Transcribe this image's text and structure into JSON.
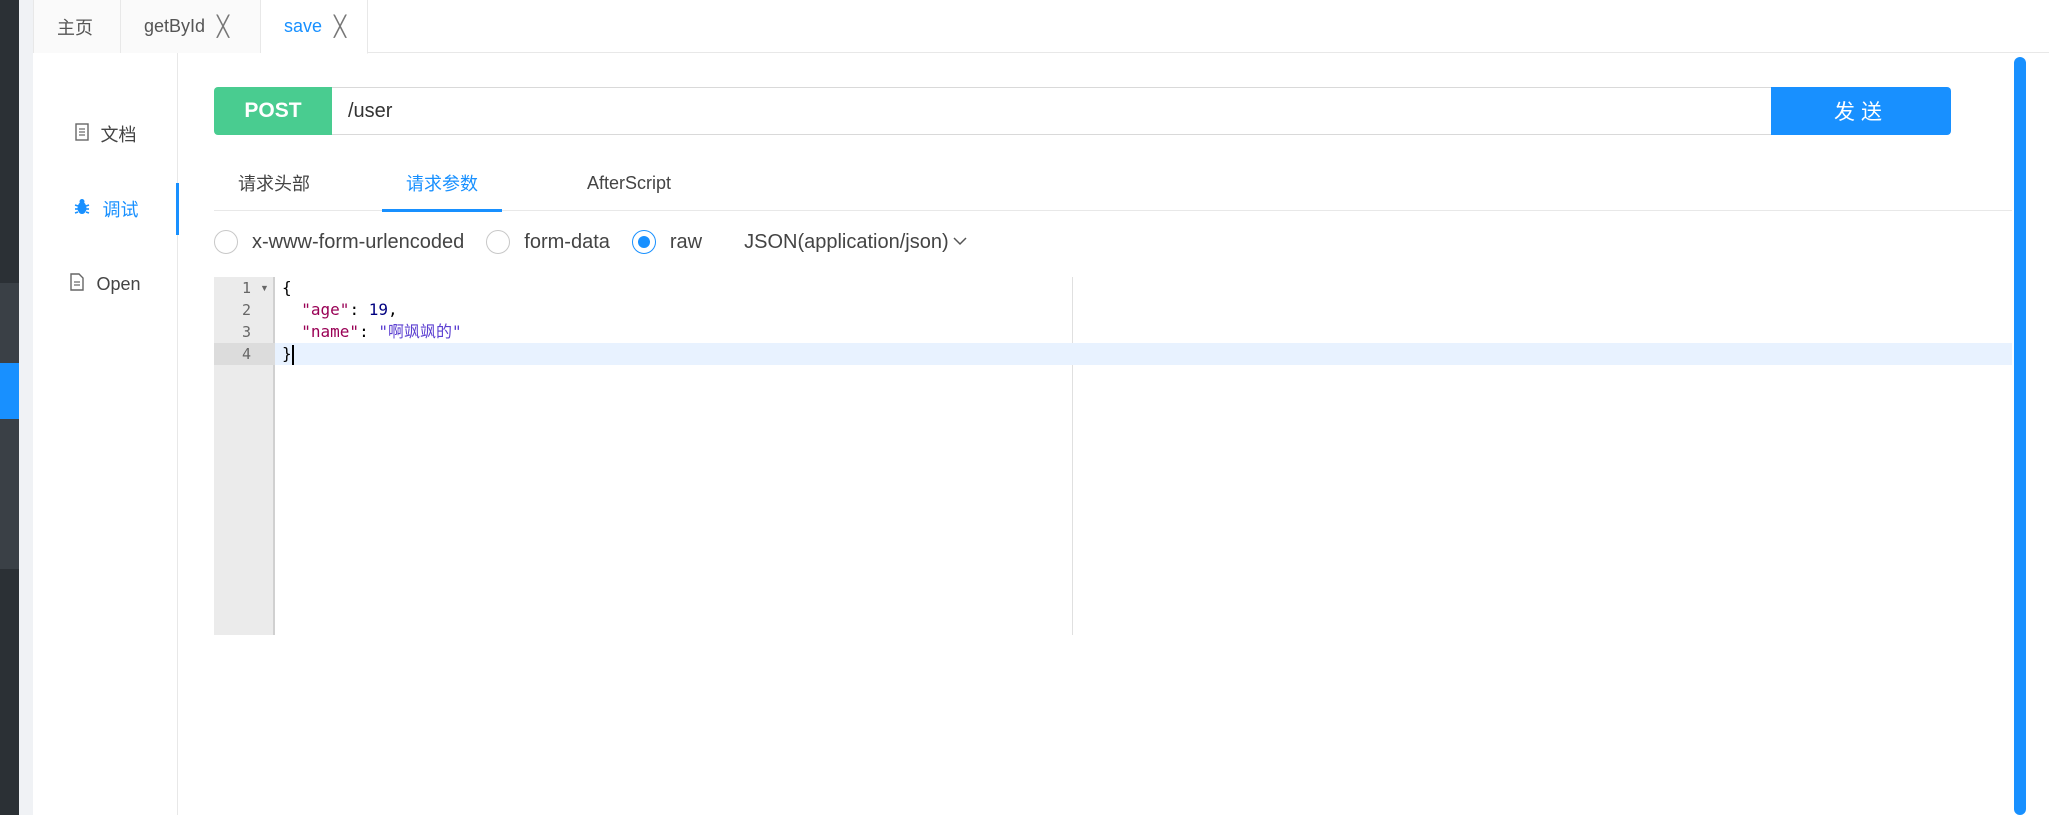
{
  "tabs": [
    {
      "label": "主页",
      "closable": false
    },
    {
      "label": "getById",
      "closable": true
    },
    {
      "label": "save",
      "closable": true,
      "active": true
    }
  ],
  "tab_close_glyph": "╳",
  "nav": {
    "doc": "文档",
    "debug": "调试",
    "open": "Open"
  },
  "request": {
    "method": "POST",
    "url": "/user",
    "send_label": "发送"
  },
  "subtabs": {
    "headers": "请求头部",
    "params": "请求参数",
    "after": "AfterScript"
  },
  "body_types": {
    "urlencoded": "x-www-form-urlencoded",
    "formdata": "form-data",
    "raw": "raw",
    "selected": "raw",
    "content_type": "JSON(application/json)"
  },
  "editor": {
    "line_numbers": [
      "1",
      "2",
      "3",
      "4"
    ],
    "active_line": 4,
    "lines": {
      "l1": "{",
      "l2_key": "\"age\"",
      "l2_sep": ": ",
      "l2_val": "19",
      "l2_end": ",",
      "l3_key": "\"name\"",
      "l3_sep": ": ",
      "l3_val": "\"啊飒飒的\"",
      "l4": "}"
    }
  },
  "colors": {
    "accent": "#1890ff",
    "post": "#49cc90"
  }
}
